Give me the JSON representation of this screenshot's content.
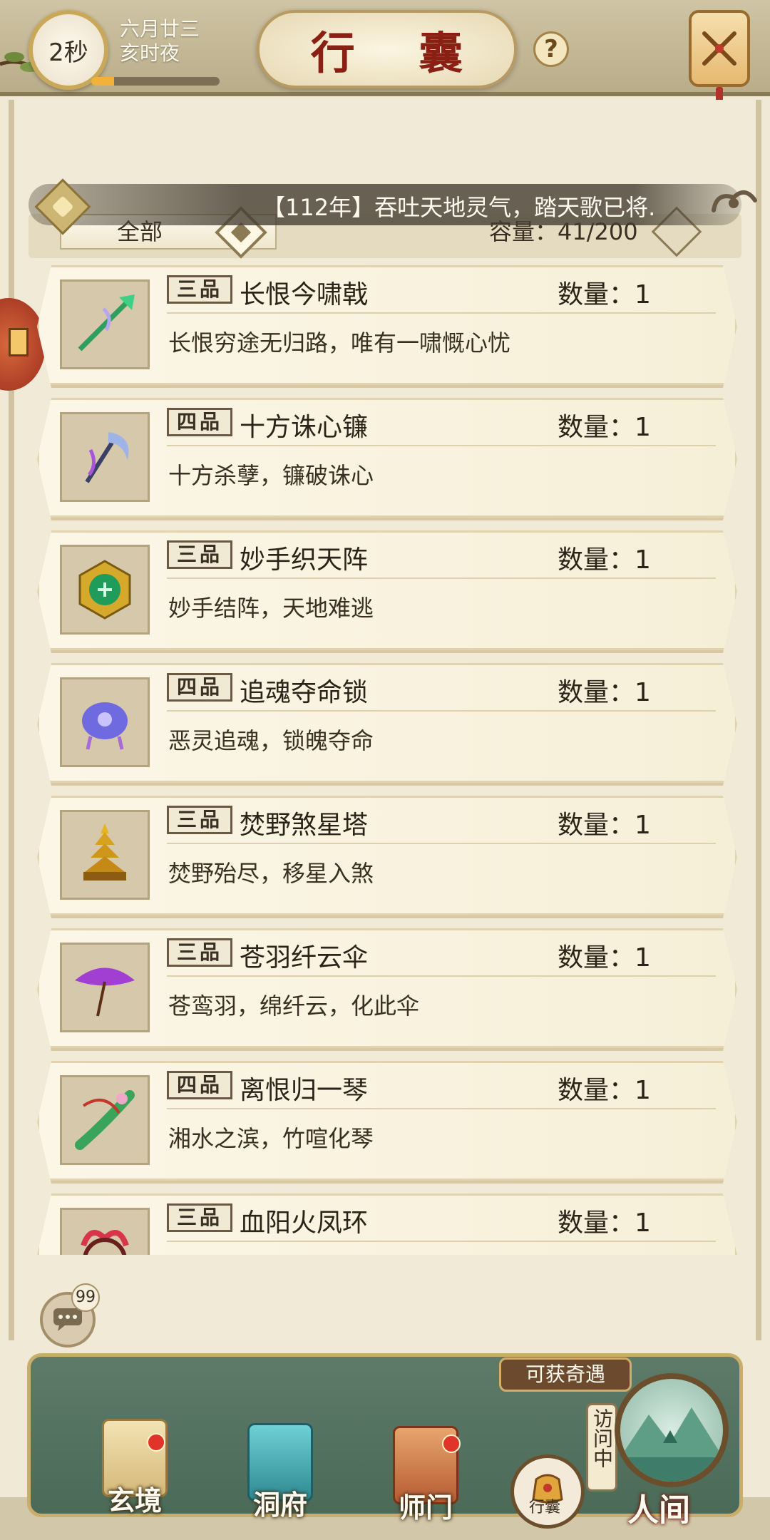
{
  "header": {
    "timer": "2秒",
    "date_line1": "六月廿三",
    "date_line2": "亥时夜",
    "day_progress": 0.18,
    "title": "行 囊",
    "help": "?"
  },
  "marquee": {
    "text": "【112年】吞吐天地灵气，踏天歌已将."
  },
  "filter": {
    "selected": "全部",
    "capacity": "容量：41/200"
  },
  "items": [
    {
      "grade": "三品",
      "name": "长恨今啸戟",
      "qty": "数量：1",
      "desc": "长恨穷途无归路，唯有一啸慨心忧",
      "icon": "halberd-icon"
    },
    {
      "grade": "四品",
      "name": "十方诛心镰",
      "qty": "数量：1",
      "desc": "十方杀孽，镰破诛心",
      "icon": "scythe-icon"
    },
    {
      "grade": "三品",
      "name": "妙手织天阵",
      "qty": "数量：1",
      "desc": "妙手结阵，天地难逃",
      "icon": "array-disc-icon"
    },
    {
      "grade": "四品",
      "name": "追魂夺命锁",
      "qty": "数量：1",
      "desc": "恶灵追魂，锁魄夺命",
      "icon": "soul-lock-icon"
    },
    {
      "grade": "三品",
      "name": "焚野煞星塔",
      "qty": "数量：1",
      "desc": "焚野殆尽，移星入煞",
      "icon": "pagoda-icon"
    },
    {
      "grade": "三品",
      "name": "苍羽纤云伞",
      "qty": "数量：1",
      "desc": "苍鸾羽，绵纤云，化此伞",
      "icon": "umbrella-icon"
    },
    {
      "grade": "四品",
      "name": "离恨归一琴",
      "qty": "数量：1",
      "desc": "湘水之滨，竹喧化琴",
      "icon": "zither-icon"
    },
    {
      "grade": "三品",
      "name": "血阳火凤环",
      "qty": "数量：1",
      "desc": "",
      "icon": "phoenix-ring-icon"
    }
  ],
  "chat": {
    "badge": "99"
  },
  "nav": {
    "xuanjing": "玄境",
    "dongfu": "洞府",
    "shimen": "师门",
    "bag": "行囊",
    "renjian": "人间",
    "encounter": "可获奇遇",
    "visiting": "访问中"
  },
  "colors": {
    "accent_red": "#8a1f14",
    "panel_bg": "#f1ead6",
    "nav_green": "#5d7b68",
    "badge_red": "#e0332a"
  }
}
